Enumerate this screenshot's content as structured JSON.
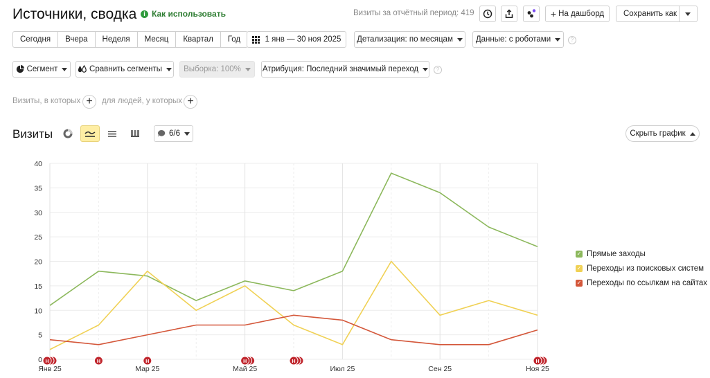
{
  "header": {
    "title": "Источники, сводка",
    "howto_label": "Как использовать",
    "visits_total": "Визиты за отчётный период: 419",
    "to_dashboard": "На дашборд",
    "save_as": "Сохранить как"
  },
  "periods": [
    "Сегодня",
    "Вчера",
    "Неделя",
    "Месяц",
    "Квартал",
    "Год"
  ],
  "toolbar": {
    "date_range": "1 янв — 30 ноя 2025",
    "detail": "Детализация: по месяцам",
    "data": "Данные: с роботами",
    "segment": "Сегмент",
    "compare": "Сравнить сегменты",
    "sample": "Выборка: 100%",
    "attribution": "Атрибуция: Последний значимый переход"
  },
  "filters": {
    "visits_where": "Визиты, в которых",
    "people_where": "для людей, у которых"
  },
  "chart_section": {
    "title": "Визиты",
    "series_count": "6/6",
    "hide_chart": "Скрыть график"
  },
  "colors": {
    "direct": "#8cb85c",
    "search": "#f0d155",
    "links": "#d4573a",
    "marker": "#c0262d",
    "active_view": "#ffeea4"
  },
  "chart_data": {
    "type": "line",
    "categories": [
      "Янв 25",
      "Фев 25",
      "Мар 25",
      "Апр 25",
      "Май 25",
      "Июн 25",
      "Июл 25",
      "Авг 25",
      "Сен 25",
      "Окт 25",
      "Ноя 25"
    ],
    "x_tick_labels": [
      "Янв 25",
      "Мар 25",
      "Май 25",
      "Июл 25",
      "Сен 25",
      "Ноя 25"
    ],
    "ylim": [
      0,
      40
    ],
    "yticks": [
      0,
      5,
      10,
      15,
      20,
      25,
      30,
      35,
      40
    ],
    "grid": true,
    "legend": "right",
    "series": [
      {
        "name": "Прямые заходы",
        "color": "#8cb85c",
        "values": [
          11,
          18,
          17,
          12,
          16,
          14,
          18,
          38,
          34,
          27,
          23
        ]
      },
      {
        "name": "Переходы из поисковых систем",
        "color": "#f0d155",
        "values": [
          2,
          7,
          18,
          10,
          15,
          7,
          3,
          20,
          9,
          12,
          9
        ]
      },
      {
        "name": "Переходы по ссылкам на сайтах",
        "color": "#d4573a",
        "values": [
          4,
          3,
          5,
          7,
          7,
          9,
          8,
          4,
          3,
          3,
          6
        ]
      }
    ],
    "annotation_marker": "Н",
    "annotation_positions": [
      0,
      1,
      2,
      4,
      5,
      10
    ]
  }
}
